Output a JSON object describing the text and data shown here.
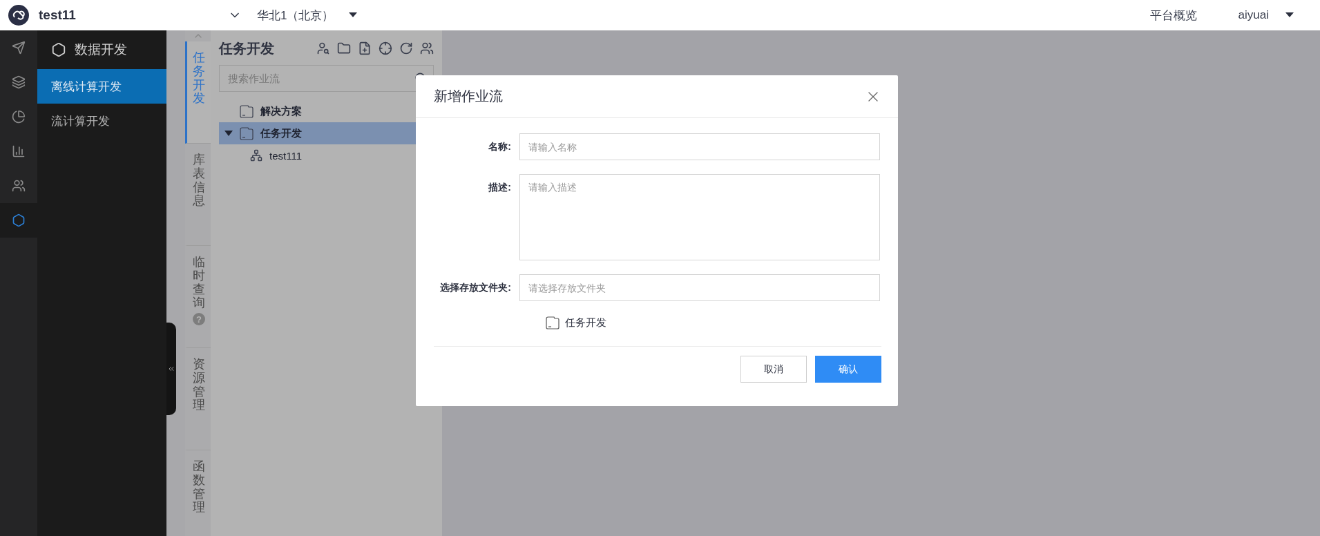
{
  "header": {
    "app_name": "test11",
    "region": "华北1（北京）",
    "nav_link": "平台概览",
    "user": "aiyuai"
  },
  "rail": [
    {
      "kind": "send",
      "selected": false
    },
    {
      "kind": "layers",
      "selected": false
    },
    {
      "kind": "pie",
      "selected": false
    },
    {
      "kind": "bars",
      "selected": false
    },
    {
      "kind": "people",
      "selected": false
    },
    {
      "kind": "dev",
      "selected": true
    }
  ],
  "sidebar": {
    "title": "数据开发",
    "items": [
      {
        "label": "离线计算开发",
        "selected": true
      },
      {
        "label": "流计算开发",
        "selected": false
      }
    ]
  },
  "side_tabs": [
    {
      "label": "任务开发",
      "selected": true
    },
    {
      "label": "库表信息",
      "selected": false
    },
    {
      "label": "临时查询",
      "selected": false,
      "badge": "?"
    },
    {
      "label": "资源管理",
      "selected": false
    },
    {
      "label": "函数管理",
      "selected": false
    }
  ],
  "tree_panel": {
    "title": "任务开发",
    "search": {
      "placeholder": "搜索作业流"
    },
    "tree": [
      {
        "label": "解决方案",
        "kind": "folder",
        "selected": false
      },
      {
        "label": "任务开发",
        "kind": "folder",
        "selected": true,
        "expanded": true,
        "children": [
          {
            "label": "test111",
            "kind": "flow",
            "selected": false
          }
        ]
      }
    ]
  },
  "dialog": {
    "title": "新增作业流",
    "fields": [
      {
        "label": "名称:",
        "kind": "input",
        "placeholder": "请输入名称"
      },
      {
        "label": "描述:",
        "kind": "textarea",
        "placeholder": "请输入描述"
      },
      {
        "label": "选择存放文件夹:",
        "kind": "input",
        "placeholder": "请选择存放文件夹"
      }
    ],
    "folders": [
      {
        "label": "任务开发"
      }
    ],
    "buttons": [
      {
        "label": "取消",
        "kind": "default"
      },
      {
        "label": "确认",
        "kind": "primary"
      }
    ]
  }
}
